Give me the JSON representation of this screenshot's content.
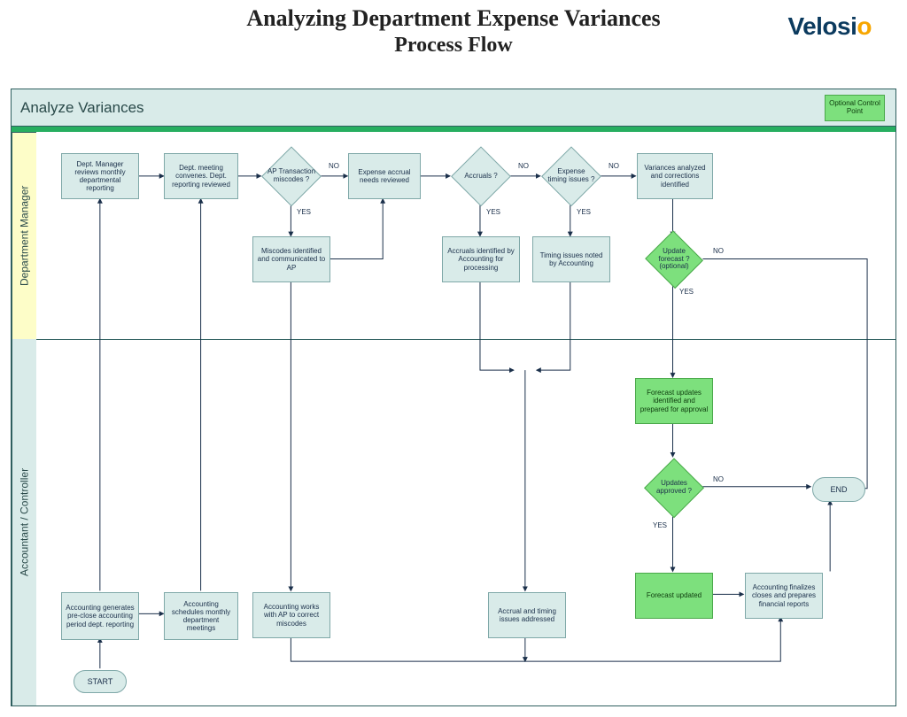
{
  "title_line1": "Analyzing Department Expense Variances",
  "title_line2": "Process Flow",
  "logo": {
    "text_primary": "Velosi",
    "accent": "o"
  },
  "diagram_title": "Analyze Variances",
  "optional_legend": "Optional Control Point",
  "lanes": {
    "dm": "Department Manager",
    "ac": "Accountant / Controller"
  },
  "terminators": {
    "start": "START",
    "end": "END"
  },
  "decisions": {
    "ap_miscodes": "AP Transaction miscodes ?",
    "accruals_q": "Accruals ?",
    "timing_q": "Expense timing issues ?",
    "update_forecast": "Update forecast ? (optional)",
    "updates_approved": "Updates approved ?"
  },
  "edge_labels": {
    "yes": "YES",
    "no": "NO"
  },
  "boxes": {
    "b_review_monthly": "Dept. Manager reviews monthly departmental reporting",
    "b_dept_meeting": "Dept. meeting convenes. Dept. reporting reviewed",
    "b_accrual_needs": "Expense accrual needs reviewed",
    "b_variance_analyzed": "Variances analyzed and corrections identified",
    "b_miscodes_id": "Miscodes identified and communicated to AP",
    "b_accruals_id": "Accruals identified by Accounting for processing",
    "b_timing_noted": "Timing issues noted by Accounting",
    "b_preclose": "Accounting generates pre-close accounting period dept. reporting",
    "b_sched_meetings": "Accounting schedules monthly department meetings",
    "b_works_ap": "Accounting works with AP to correct miscodes",
    "b_accrual_timing_addr": "Accrual and timing issues addressed",
    "b_forecast_prep": "Forecast updates identified and prepared for approval",
    "b_forecast_updated": "Forecast updated",
    "b_finalize": "Accounting finalizes closes and prepares financial reports"
  }
}
